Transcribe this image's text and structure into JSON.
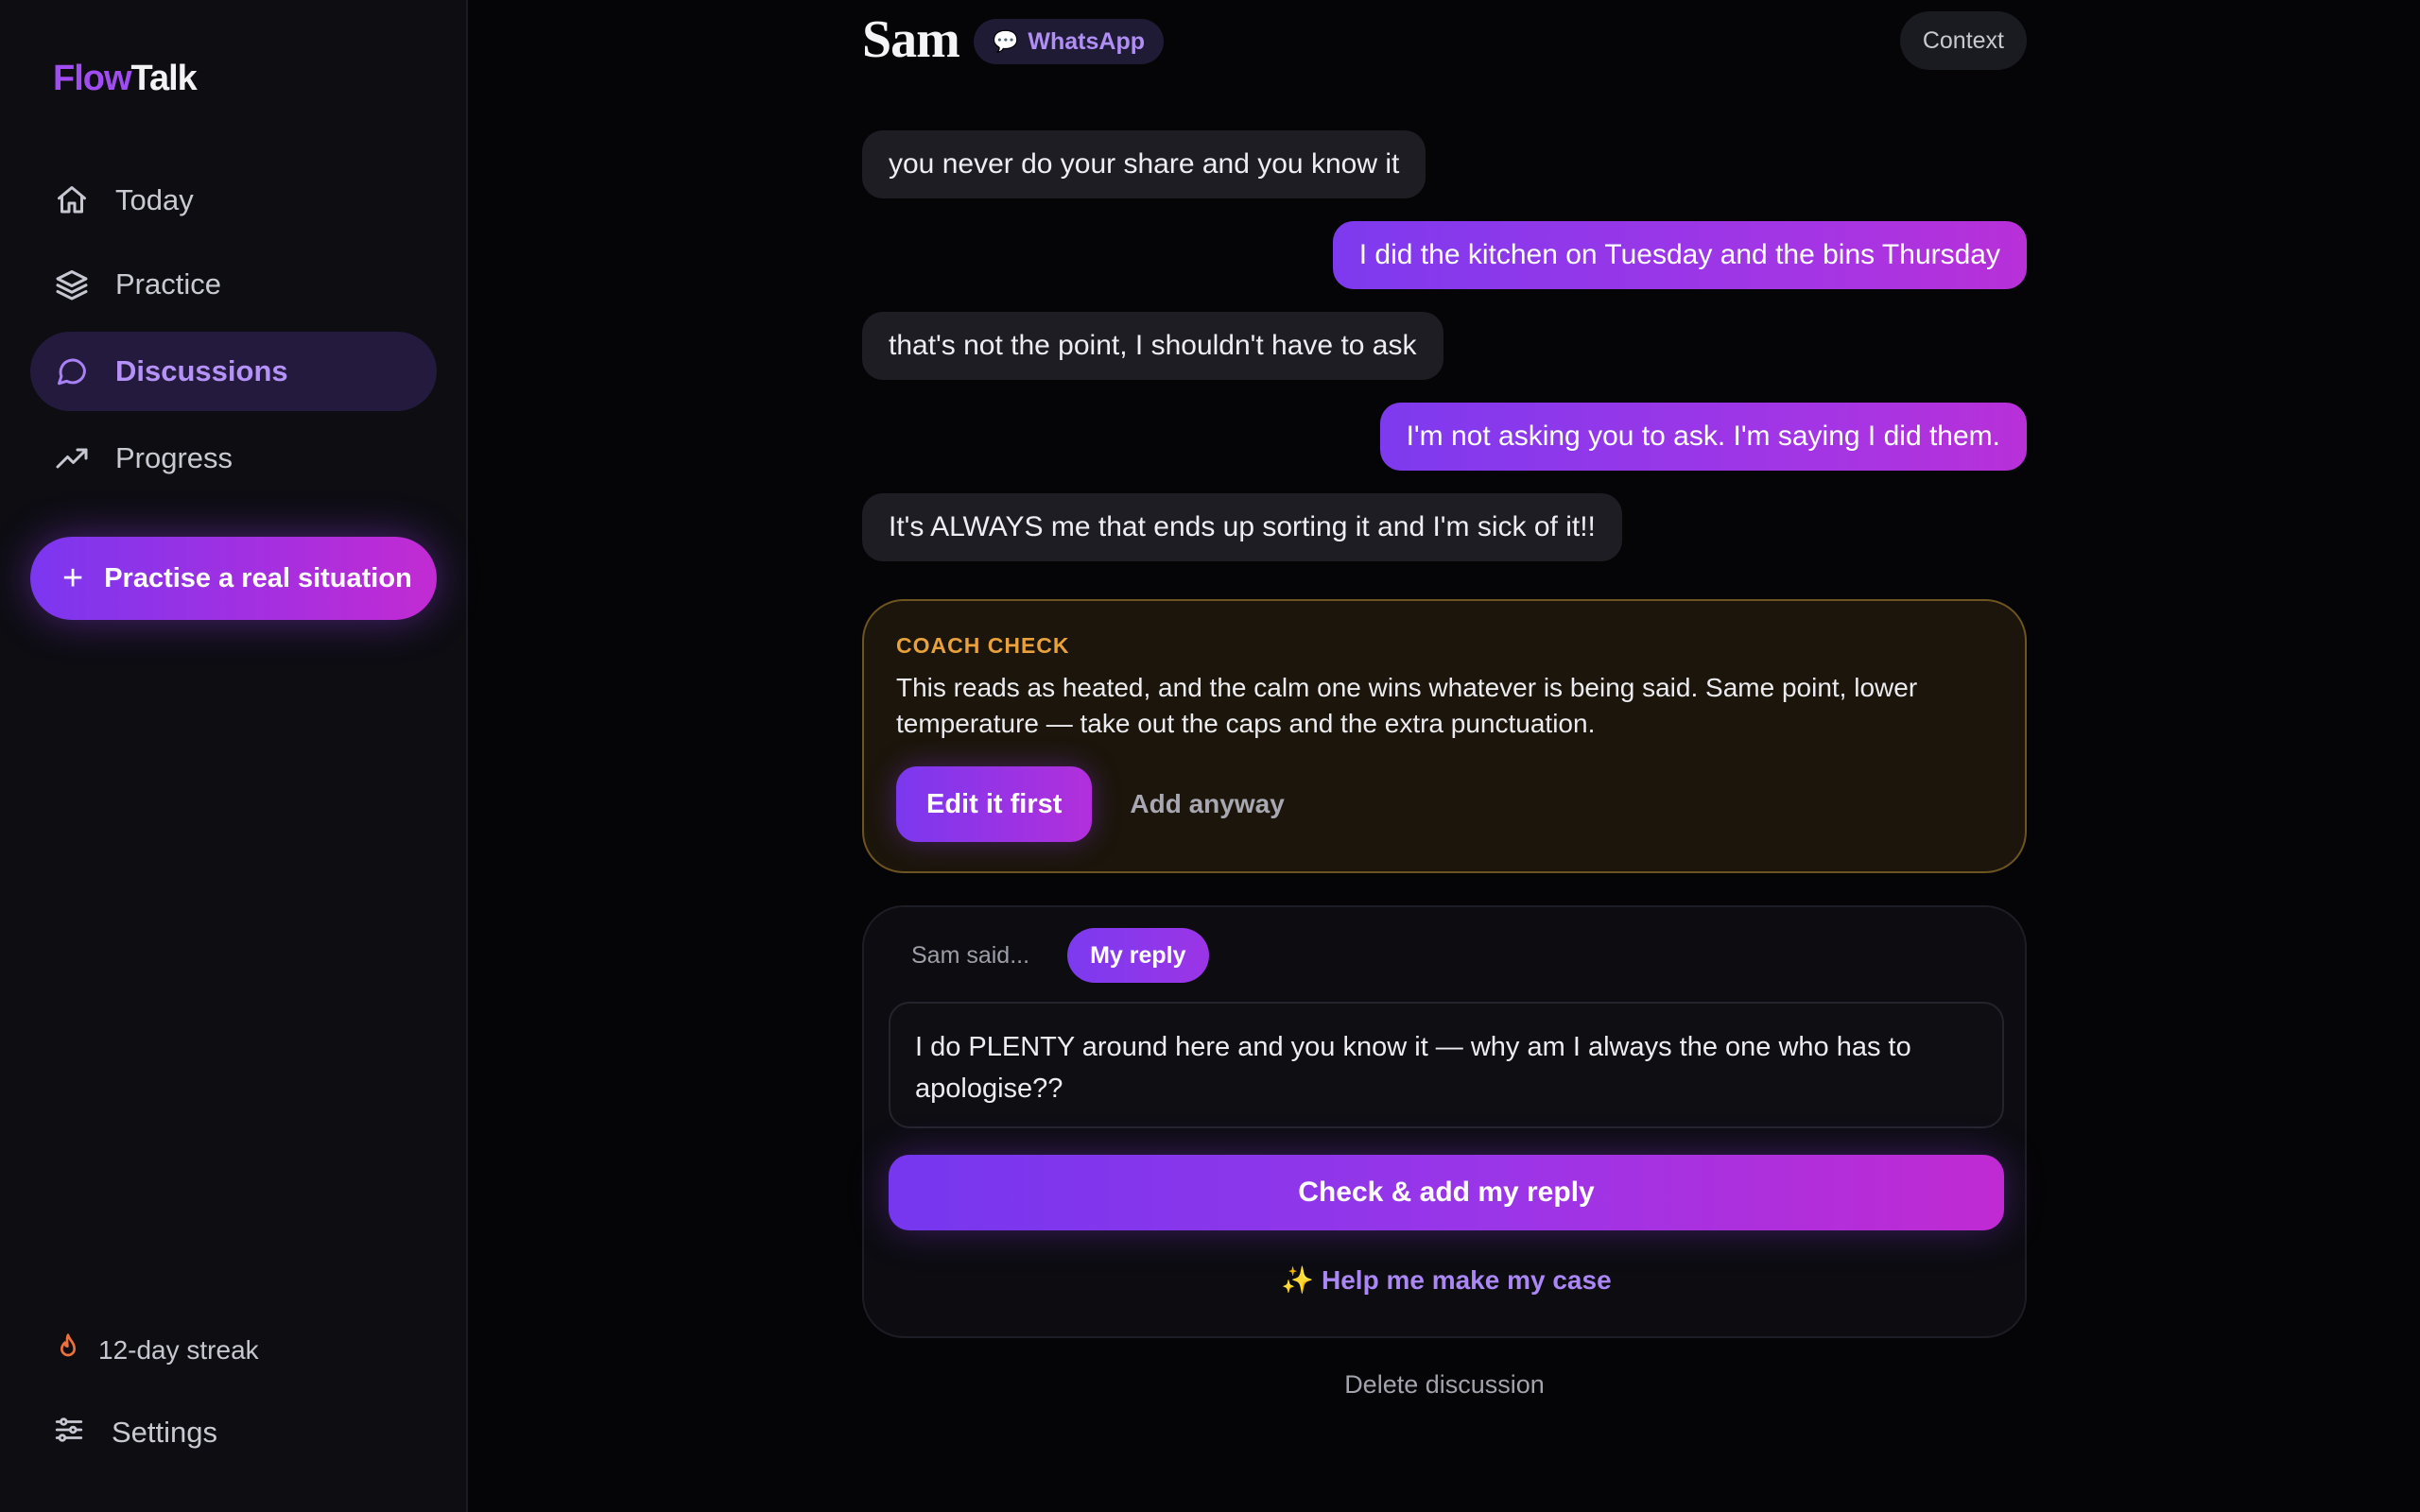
{
  "brand": {
    "logo_part1": "Flow",
    "logo_part2": "Talk",
    "accent": "#9f4cf0"
  },
  "sidebar": {
    "items": [
      {
        "label": "Today",
        "icon": "home-icon",
        "active": false
      },
      {
        "label": "Practice",
        "icon": "layers-icon",
        "active": false
      },
      {
        "label": "Discussions",
        "icon": "chat-bubble-icon",
        "active": true
      },
      {
        "label": "Progress",
        "icon": "trending-up-icon",
        "active": false
      }
    ],
    "cta_label": "Practise a real situation",
    "streak_label": "12-day streak",
    "settings_label": "Settings"
  },
  "header": {
    "contact_name": "Sam",
    "channel_label": "WhatsApp",
    "context_label": "Context"
  },
  "thread": {
    "messages": [
      {
        "from": "them",
        "text": "you never do your share and you know it"
      },
      {
        "from": "me",
        "text": "I did the kitchen on Tuesday and the bins Thursday"
      },
      {
        "from": "them",
        "text": "that's not the point, I shouldn't have to ask"
      },
      {
        "from": "me",
        "text": "I'm not asking you to ask. I'm saying I did them."
      },
      {
        "from": "them",
        "text": "It's ALWAYS me that ends up sorting it and I'm sick of it!!"
      }
    ]
  },
  "coach": {
    "title": "COACH CHECK",
    "body": "This reads as heated, and the calm one wins whatever is being said. Same point, lower temperature — take out the caps and the extra punctuation.",
    "primary_label": "Edit it first",
    "secondary_label": "Add anyway"
  },
  "composer": {
    "tab_them": "Sam said...",
    "tab_me": "My reply",
    "active_tab": "My reply",
    "reply_value": "I do PLENTY around here and you know it — why am I always the one who has to apologise??",
    "submit_label": "Check & add my reply",
    "help_label": "✨ Help me make my case"
  },
  "footer": {
    "delete_label": "Delete discussion"
  }
}
